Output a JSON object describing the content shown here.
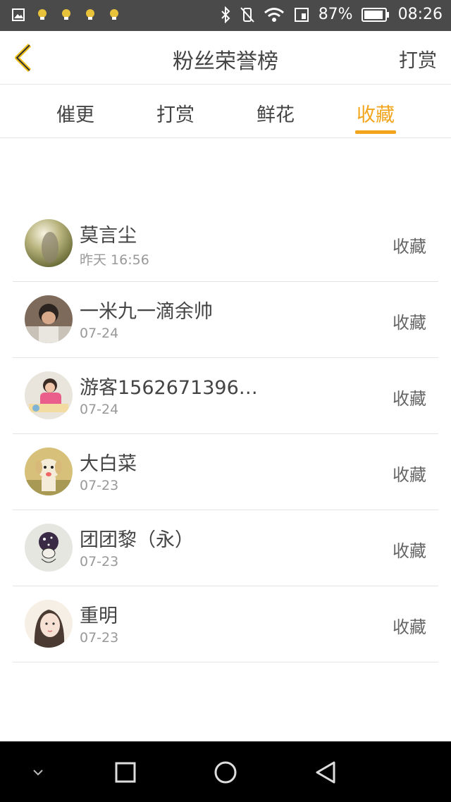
{
  "status": {
    "battery": "87%",
    "time": "08:26"
  },
  "header": {
    "title": "粉丝荣誉榜",
    "action": "打赏"
  },
  "tabs": [
    {
      "label": "催更",
      "active": false
    },
    {
      "label": "打赏",
      "active": false
    },
    {
      "label": "鲜花",
      "active": false
    },
    {
      "label": "收藏",
      "active": true
    }
  ],
  "fans": [
    {
      "name": "莫言尘",
      "date": "昨天 16:56",
      "action": "收藏",
      "avatar": "avatar-photo-1"
    },
    {
      "name": "一米九一滴余帅",
      "date": "07-24",
      "action": "收藏",
      "avatar": "avatar-photo-2"
    },
    {
      "name": "游客1562671396…",
      "date": "07-24",
      "action": "收藏",
      "avatar": "avatar-photo-3"
    },
    {
      "name": "大白菜",
      "date": "07-23",
      "action": "收藏",
      "avatar": "avatar-dog"
    },
    {
      "name": "团团黎（永）",
      "date": "07-23",
      "action": "收藏",
      "avatar": "avatar-drawing"
    },
    {
      "name": "重明",
      "date": "07-23",
      "action": "收藏",
      "avatar": "avatar-portrait"
    }
  ],
  "colors": {
    "accent": "#f2a51c",
    "status_bar": "#4a4a4a",
    "nav_bar": "#000000"
  }
}
